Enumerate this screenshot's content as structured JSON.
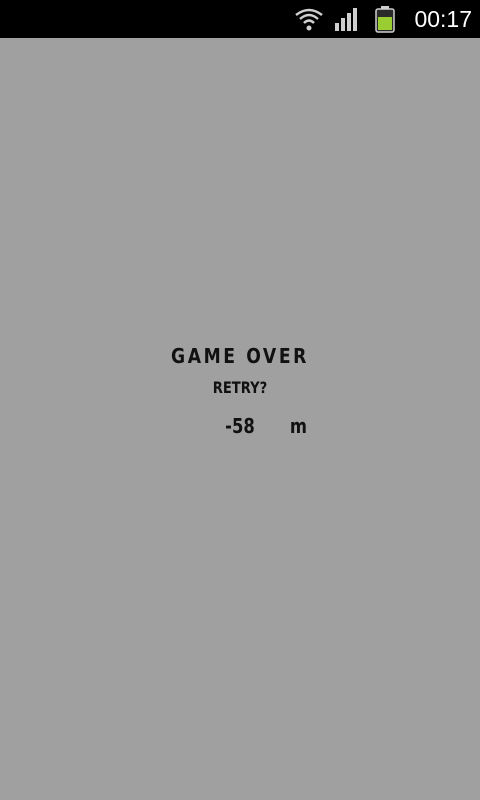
{
  "status_bar": {
    "time": "00:17",
    "icons": [
      "wifi-icon",
      "signal-icon",
      "battery-icon"
    ],
    "battery_color": "#9acd32"
  },
  "game": {
    "background_color": "#a0a0a0",
    "title": "GAME OVER",
    "retry_label": "RETRY?",
    "distance": "-58",
    "distance_unit": "m"
  }
}
